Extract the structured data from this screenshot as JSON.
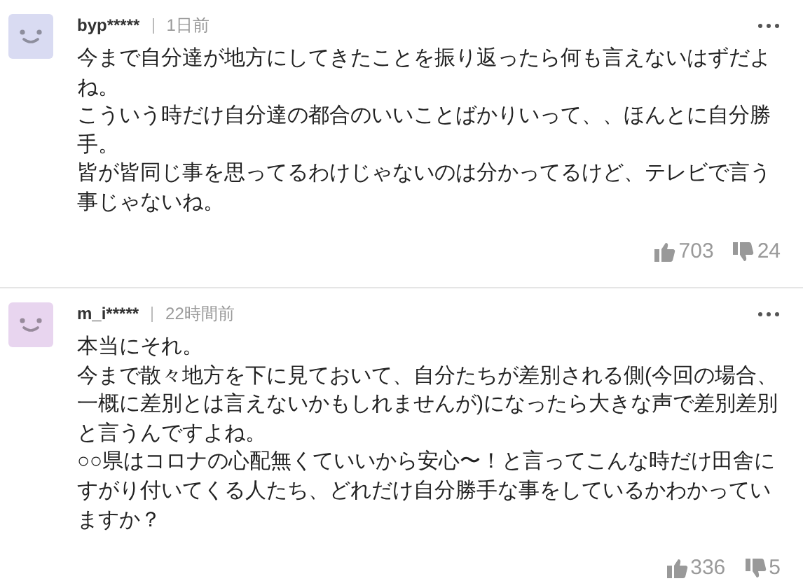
{
  "comments": [
    {
      "user": "byp*****",
      "time": "1日前",
      "color": "#d9dbf2",
      "paragraphs": [
        "今まで自分達が地方にしてきたことを振り返ったら何も言えないはずだよね。",
        "こういう時だけ自分達の都合のいいことばかりいって、、ほんとに自分勝手。",
        "皆が皆同じ事を思ってるわけじゃないのは分かってるけど、テレビで言う事じゃないね。"
      ],
      "likes": "703",
      "dislikes": "24"
    },
    {
      "user": "m_i*****",
      "time": "22時間前",
      "color": "#e8d5ef",
      "paragraphs": [
        "本当にそれ。",
        "今まで散々地方を下に見ておいて、自分たちが差別される側(今回の場合、一概に差別とは言えないかもしれませんが)になったら大きな声で差別差別と言うんですよね。",
        "○○県はコロナの心配無くていいから安心〜！と言ってこんな時だけ田舎にすがり付いてくる人たち、どれだけ自分勝手な事をしているかわかっていますか？"
      ],
      "likes": "336",
      "dislikes": "5"
    }
  ]
}
